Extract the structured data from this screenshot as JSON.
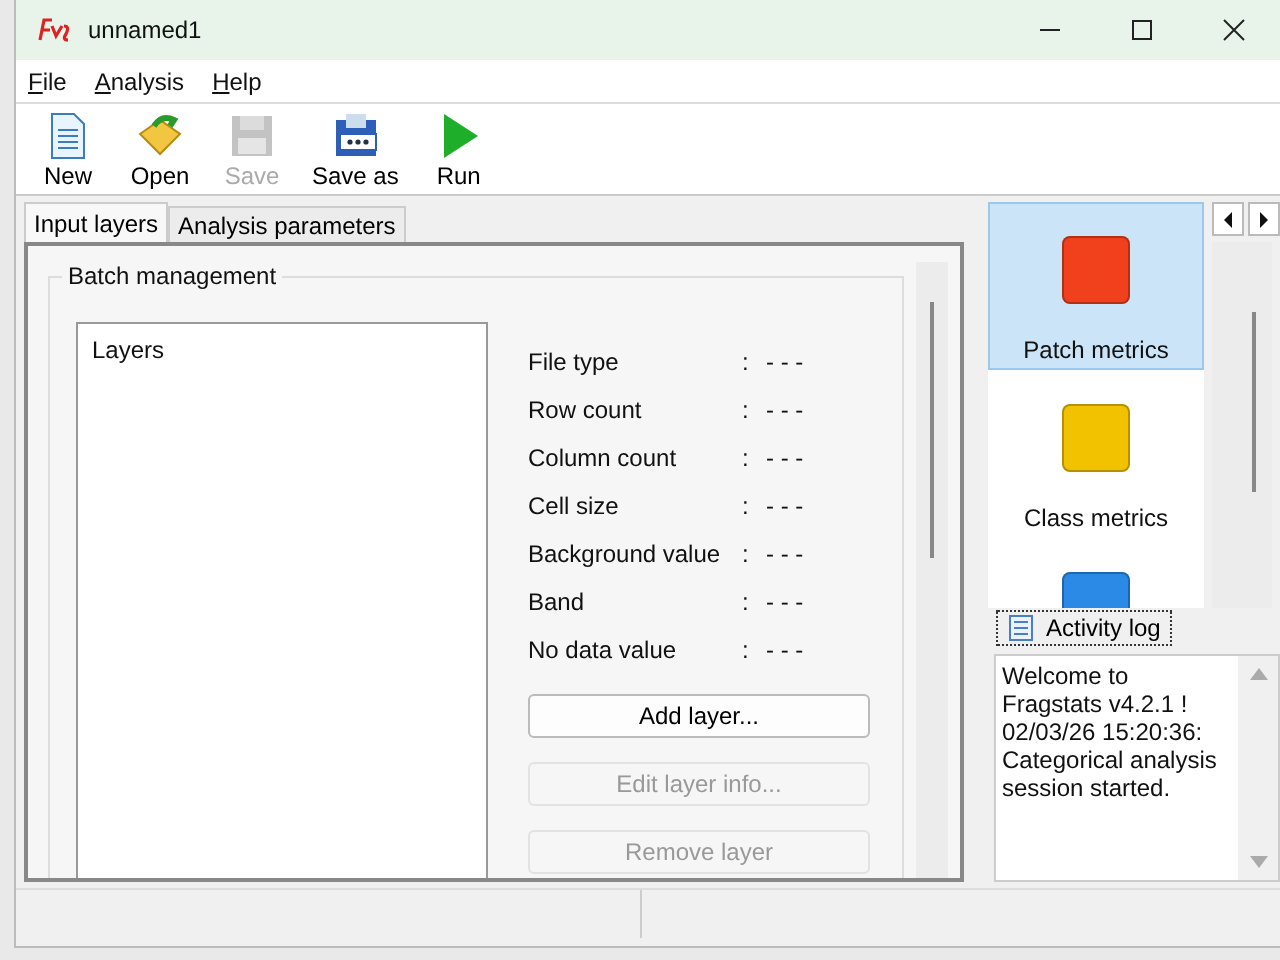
{
  "window": {
    "title": "unnamed1"
  },
  "menu": [
    {
      "label": "File"
    },
    {
      "label": "Analysis"
    },
    {
      "label": "Help"
    }
  ],
  "toolbar": [
    {
      "label": "New",
      "kind": "new",
      "disabled": false
    },
    {
      "label": "Open",
      "kind": "open",
      "disabled": false
    },
    {
      "label": "Save",
      "kind": "save",
      "disabled": true
    },
    {
      "label": "Save as",
      "kind": "saveas",
      "disabled": false
    },
    {
      "label": "Run",
      "kind": "run",
      "disabled": false
    }
  ],
  "tabs": [
    {
      "label": "Input layers",
      "selected": true
    },
    {
      "label": "Analysis parameters",
      "selected": false
    }
  ],
  "batch": {
    "title": "Batch management",
    "layers_header": "Layers",
    "fields": [
      {
        "label": "File type",
        "sep": ":",
        "value": "- - -"
      },
      {
        "label": "Row count",
        "sep": ":",
        "value": "- - -"
      },
      {
        "label": "Column count",
        "sep": ":",
        "value": "- - -"
      },
      {
        "label": "Cell size",
        "sep": ":",
        "value": "- - -"
      },
      {
        "label": "Background value",
        "sep": ":",
        "value": "- - -"
      },
      {
        "label": "Band",
        "sep": ":",
        "value": "- - -"
      },
      {
        "label": "No data value",
        "sep": ":",
        "value": "- - -"
      }
    ],
    "buttons": [
      {
        "label": "Add layer...",
        "disabled": false
      },
      {
        "label": "Edit layer info...",
        "disabled": true
      },
      {
        "label": "Remove layer",
        "disabled": true
      }
    ]
  },
  "metrics": [
    {
      "label": "Patch metrics",
      "color": "#f0401c",
      "selected": true
    },
    {
      "label": "Class metrics",
      "color": "#f2c200",
      "selected": false
    },
    {
      "color": "#2a8ae6",
      "selected": false
    }
  ],
  "activity_log": {
    "tab": "Activity log",
    "text": "Welcome to Fragstats v4.2.1 ! 02/03/26 15:20:36: Categorical analysis session started."
  }
}
